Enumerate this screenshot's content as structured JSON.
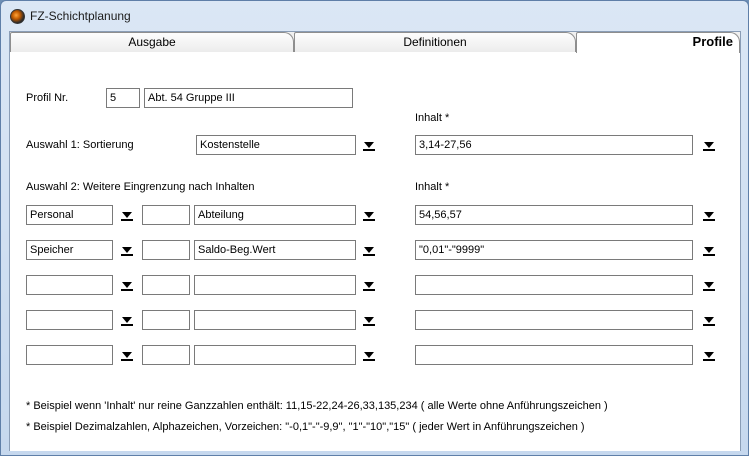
{
  "window": {
    "title": "FZ-Schichtplanung"
  },
  "tabs": [
    {
      "label": "Ausgabe"
    },
    {
      "label": "Definitionen"
    },
    {
      "label": "Profile"
    }
  ],
  "profile": {
    "nr_label": "Profil Nr.",
    "nr_value": "5",
    "name_value": "Abt. 54 Gruppe III"
  },
  "auswahl1": {
    "label": "Auswahl 1:  Sortierung",
    "value": "Kostenstelle",
    "inhalt_label": "Inhalt *",
    "inhalt_value": "3,14-27,56"
  },
  "auswahl2": {
    "label": "Auswahl 2:  Weitere Eingrenzung nach Inhalten",
    "inhalt_label": "Inhalt *",
    "rows": [
      {
        "type": "Personal",
        "code": "",
        "field": "Abteilung",
        "inhalt": "54,56,57"
      },
      {
        "type": "Speicher",
        "code": "",
        "field": "Saldo-Beg.Wert",
        "inhalt": "\"0,01\"-\"9999\""
      },
      {
        "type": "",
        "code": "",
        "field": "",
        "inhalt": ""
      },
      {
        "type": "",
        "code": "",
        "field": "",
        "inhalt": ""
      },
      {
        "type": "",
        "code": "",
        "field": "",
        "inhalt": ""
      }
    ]
  },
  "notes": [
    "* Beispiel wenn 'Inhalt' nur reine Ganzzahlen enthält:  11,15-22,24-26,33,135,234   ( alle Werte ohne Anführungszeichen )",
    "* Beispiel Dezimalzahlen, Alphazeichen, Vorzeichen:  \"-0,1\"-\"-9,9\", \"1\"-\"10\",\"15\"   ( jeder Wert in Anführungszeichen )"
  ]
}
